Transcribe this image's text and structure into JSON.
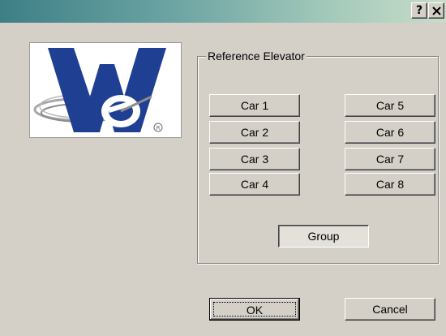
{
  "window": {
    "help_glyph": "?",
    "close_icon": "close-icon"
  },
  "logo": {
    "icon": "company-logo-we",
    "colors": {
      "blue": "#1f3f93",
      "gray": "#8c8c8c"
    }
  },
  "reference_elevator": {
    "label": "Reference Elevator",
    "cars_left": [
      "Car 1",
      "Car 2",
      "Car 3",
      "Car 4"
    ],
    "cars_right": [
      "Car 5",
      "Car 6",
      "Car 7",
      "Car 8"
    ],
    "group_label": "Group"
  },
  "footer": {
    "ok_label": "OK",
    "cancel_label": "Cancel"
  }
}
